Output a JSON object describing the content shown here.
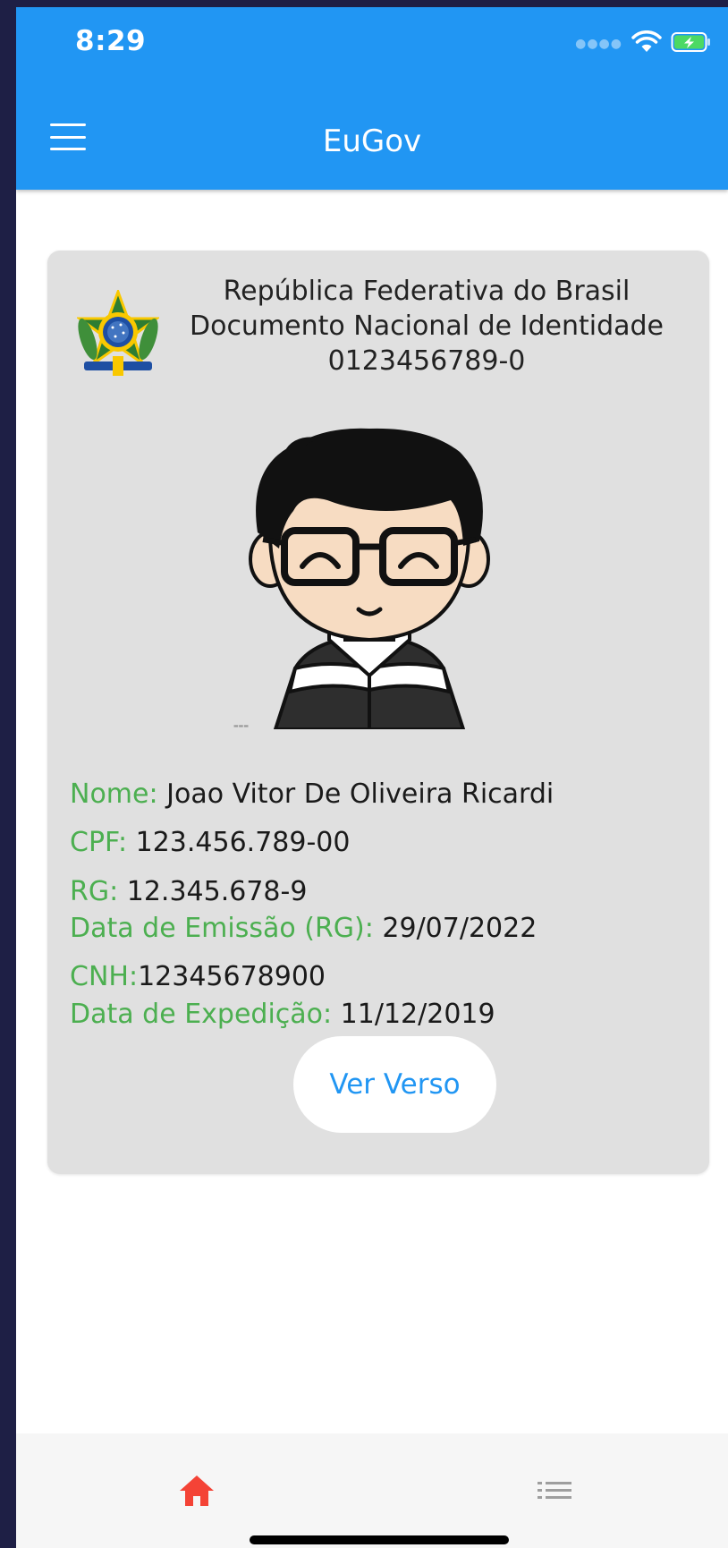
{
  "status_bar": {
    "time": "8:29",
    "signal_icon": "signal-dots-icon",
    "wifi_icon": "wifi-icon",
    "battery_icon": "battery-charging-icon"
  },
  "header": {
    "title": "EuGov",
    "menu_icon": "hamburger-menu-icon"
  },
  "card": {
    "emblem_icon": "brazil-coat-of-arms-icon",
    "line1": "República Federativa do Brasil",
    "line2": "Documento Nacional de Identidade",
    "document_number": "0123456789-0",
    "photo": "cartoon-avatar-photo",
    "fields": {
      "nome_label": "Nome:",
      "nome_value": " Joao Vitor De Oliveira Ricardi",
      "cpf_label": "CPF:",
      "cpf_value": " 123.456.789-00",
      "rg_label": "RG:",
      "rg_value": " 12.345.678-9",
      "emissao_label": "Data de Emissão (RG):",
      "emissao_value": " 29/07/2022",
      "cnh_label": "CNH:",
      "cnh_value": "12345678900",
      "expedicao_label": "Data de Expedição:",
      "expedicao_value": " 11/12/2019"
    },
    "verso_button": "Ver Verso"
  },
  "tabbar": {
    "home_icon": "home-icon",
    "list_icon": "list-icon",
    "active_color": "#f44336",
    "inactive_color": "#9e9e9e"
  },
  "colors": {
    "primary": "#2196f3",
    "label_green": "#4caf50",
    "card_bg": "#e0e0e0"
  }
}
